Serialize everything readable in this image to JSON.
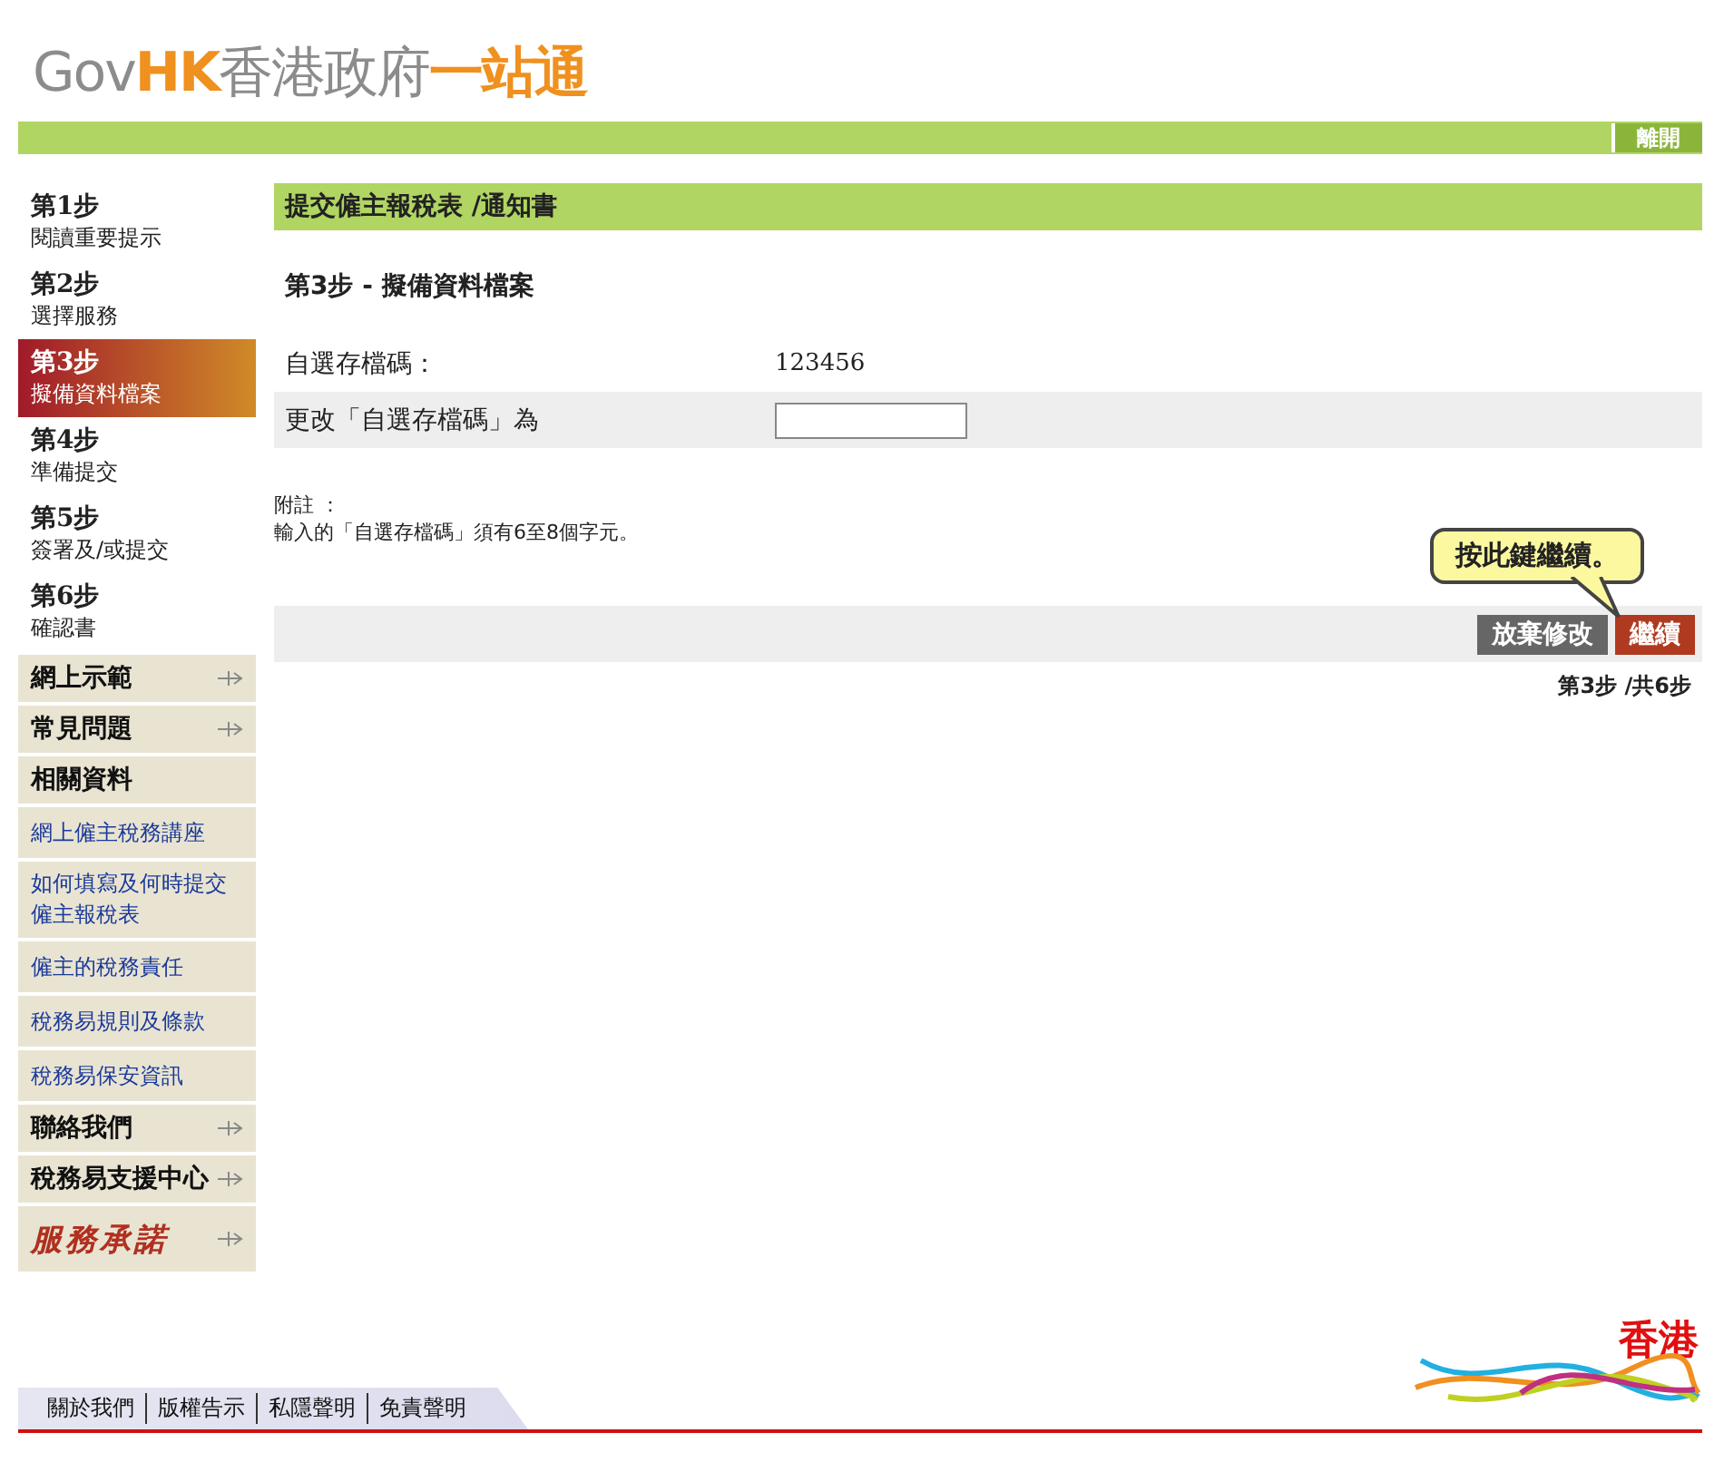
{
  "header": {
    "logo_latin_grey": "Gov",
    "logo_latin_orange": "HK",
    "logo_cjk_grey": "香港政府",
    "logo_cjk_orange": "一站通",
    "exit_button": "離開"
  },
  "sidebar": {
    "steps": [
      {
        "step": "第1步",
        "label": "閱讀重要提示",
        "selected": false
      },
      {
        "step": "第2步",
        "label": "選擇服務",
        "selected": false
      },
      {
        "step": "第3步",
        "label": "擬備資料檔案",
        "selected": true
      },
      {
        "step": "第4步",
        "label": "準備提交",
        "selected": false
      },
      {
        "step": "第5步",
        "label": "簽署及/或提交",
        "selected": false
      },
      {
        "step": "第6步",
        "label": "確認書",
        "selected": false
      }
    ],
    "menu": [
      {
        "kind": "section",
        "label": "網上示範"
      },
      {
        "kind": "section",
        "label": "常見問題"
      },
      {
        "kind": "heading",
        "label": "相關資料"
      },
      {
        "kind": "link",
        "label": "網上僱主稅務講座"
      },
      {
        "kind": "link",
        "label": "如何填寫及何時提交僱主報稅表"
      },
      {
        "kind": "link",
        "label": "僱主的稅務責任"
      },
      {
        "kind": "link",
        "label": "稅務易規則及條款"
      },
      {
        "kind": "link",
        "label": "稅務易保安資訊"
      },
      {
        "kind": "section",
        "label": "聯絡我們"
      },
      {
        "kind": "section",
        "label": "稅務易支援中心"
      },
      {
        "kind": "brand",
        "label": "服務承諾"
      }
    ]
  },
  "main": {
    "title": "提交僱主報稅表 /通知書",
    "step_heading": "第3步 - 擬備資料檔案",
    "fields": [
      {
        "kind": "value",
        "label": "自選存檔碼：",
        "value": "123456"
      },
      {
        "kind": "input",
        "label": "更改「自選存檔碼」為"
      }
    ],
    "note_title": "附註 ：",
    "note_text": "輸入的「自選存檔碼」須有6至8個字元。",
    "callout": "按此鍵繼續。",
    "buttons": [
      {
        "kind": "secondary",
        "label": "放棄修改"
      },
      {
        "kind": "primary",
        "label": "繼續"
      }
    ],
    "step_counter": "第3步 /共6步"
  },
  "footer": {
    "links": [
      "關於我們",
      "版權告示",
      "私隱聲明",
      "免責聲明"
    ],
    "brand": "香港"
  }
}
